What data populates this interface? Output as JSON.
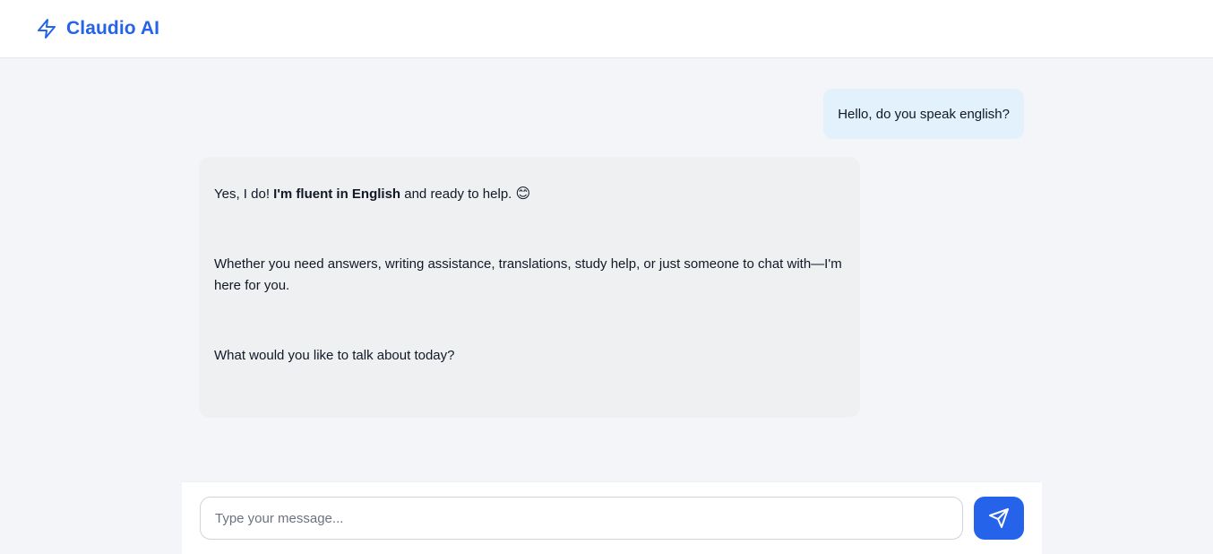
{
  "app": {
    "title": "Claudio AI",
    "brand_icon": "lightning-bolt-icon",
    "accent_color": "#2563eb"
  },
  "messages": [
    {
      "role": "user",
      "text": "Hello, do you speak english?"
    },
    {
      "role": "assistant",
      "paragraphs": [
        {
          "pre": "Yes, I do! ",
          "bold": "I'm fluent in English",
          "post": " and ready to help. ",
          "emoji": "😊"
        },
        {
          "text": "Whether you need answers, writing assistance, translations, study help, or just someone to chat with—I'm here for you."
        },
        {
          "text": "What would you like to talk about today?"
        }
      ]
    }
  ],
  "composer": {
    "placeholder": "Type your message...",
    "value": "",
    "send_icon": "send-paper-plane-icon"
  }
}
